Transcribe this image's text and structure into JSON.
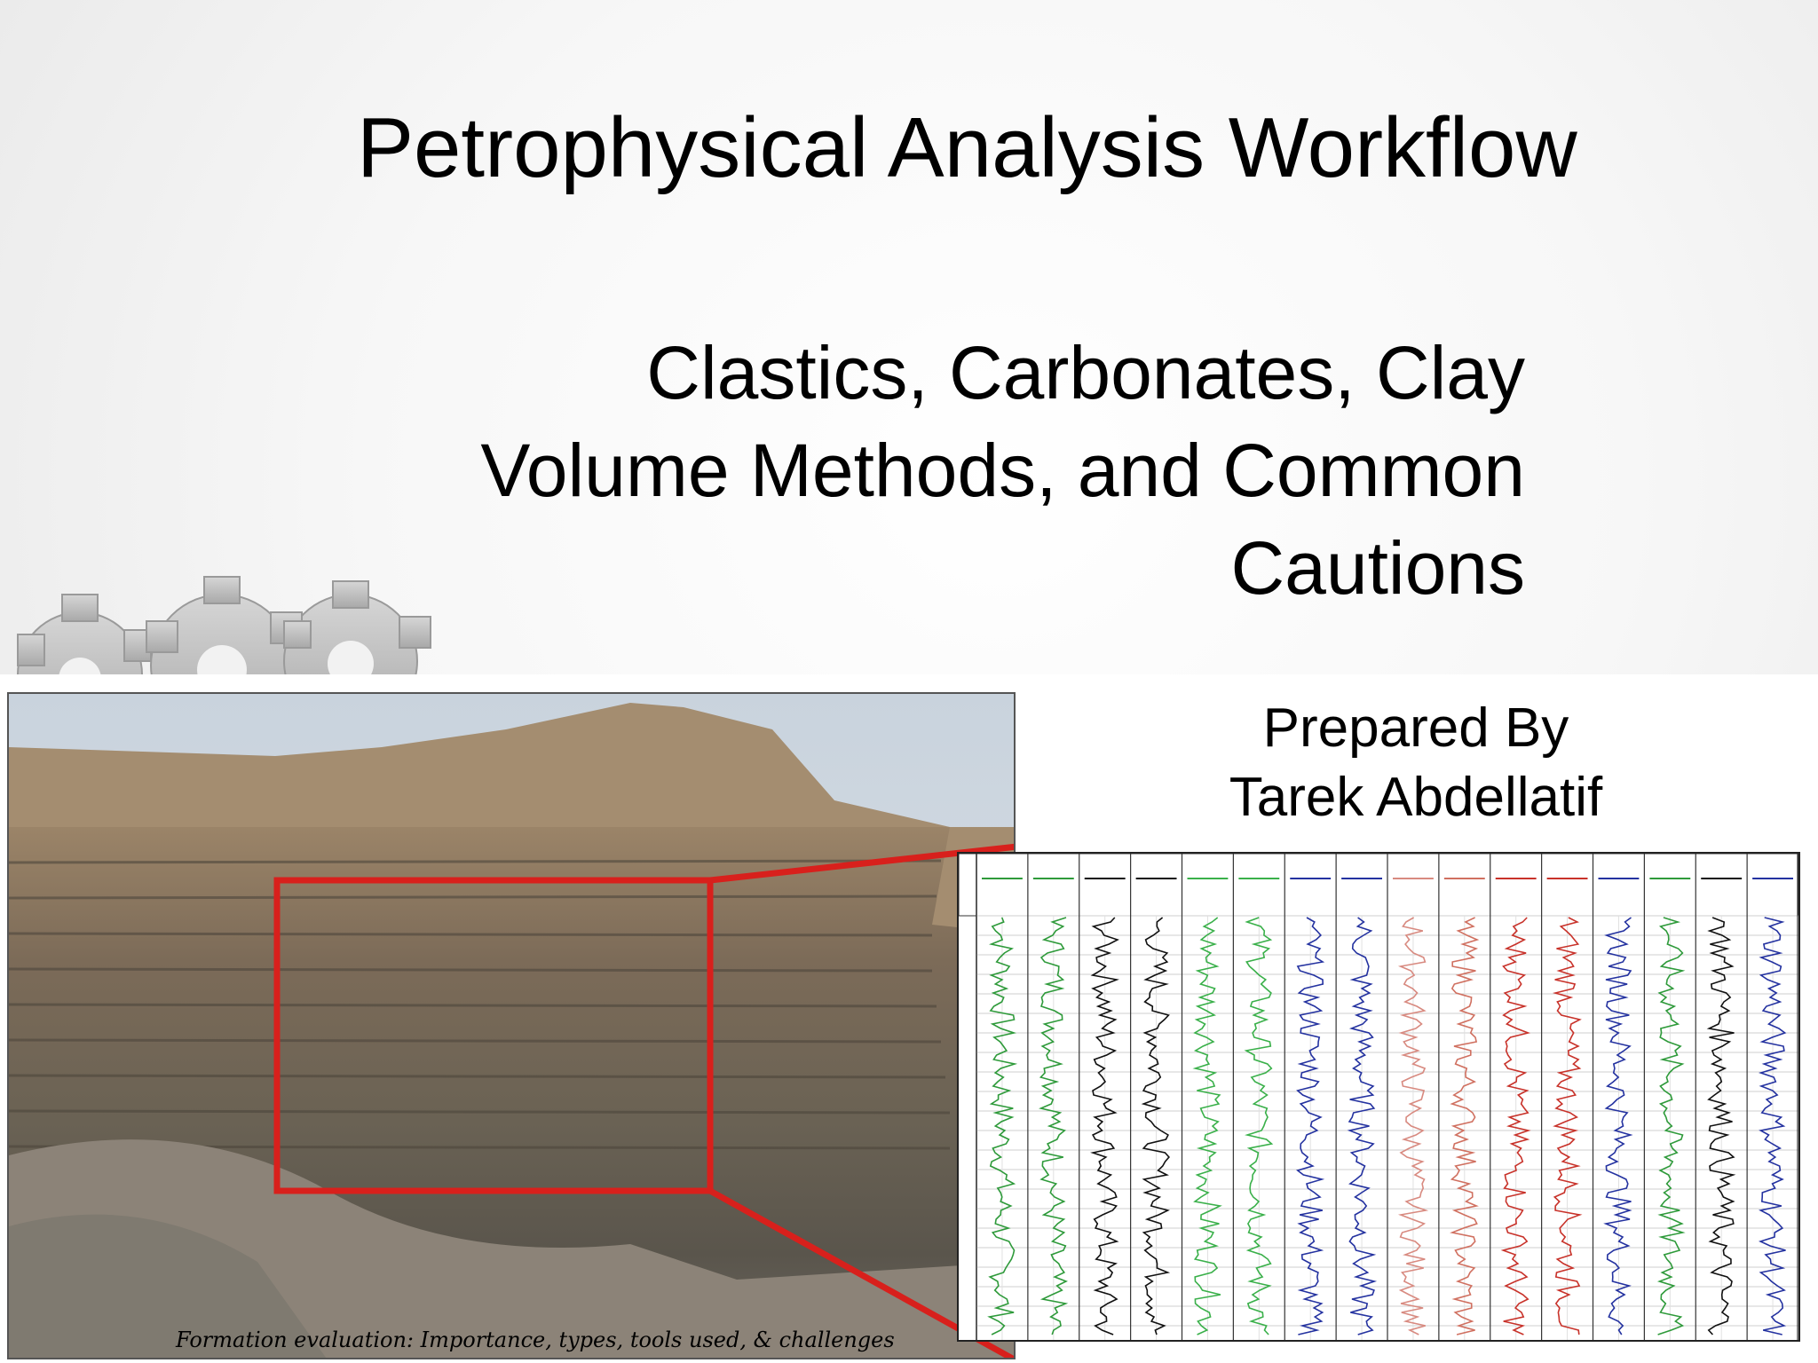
{
  "slide": {
    "title": "Petrophysical Analysis Workflow",
    "subtitle_lines": [
      "Clastics, Carbonates, Clay",
      "Volume Methods, and Common",
      "Cautions"
    ],
    "prepared_by_label": "Prepared By",
    "author": "Tarek Abdellatif",
    "figure_caption": "Formation evaluation: Importance, types, tools used, & challenges"
  },
  "colors": {
    "outline_red": "#d8201c",
    "log_green": "#2e9a3a",
    "log_blue": "#2432a0",
    "log_black": "#111111",
    "log_red": "#c8322a",
    "log_pink": "#d88a80"
  },
  "icons": {
    "gears": "gears-decoration-icon"
  },
  "log_track_colors": [
    "#2e9a3a",
    "#2e9a3a",
    "#111111",
    "#111111",
    "#3ab04a",
    "#3ab04a",
    "#2432a0",
    "#2432a0",
    "#d88a80",
    "#d07060",
    "#c8322a",
    "#c8322a",
    "#2432a0",
    "#2e9a3a",
    "#111111",
    "#2432a0"
  ]
}
